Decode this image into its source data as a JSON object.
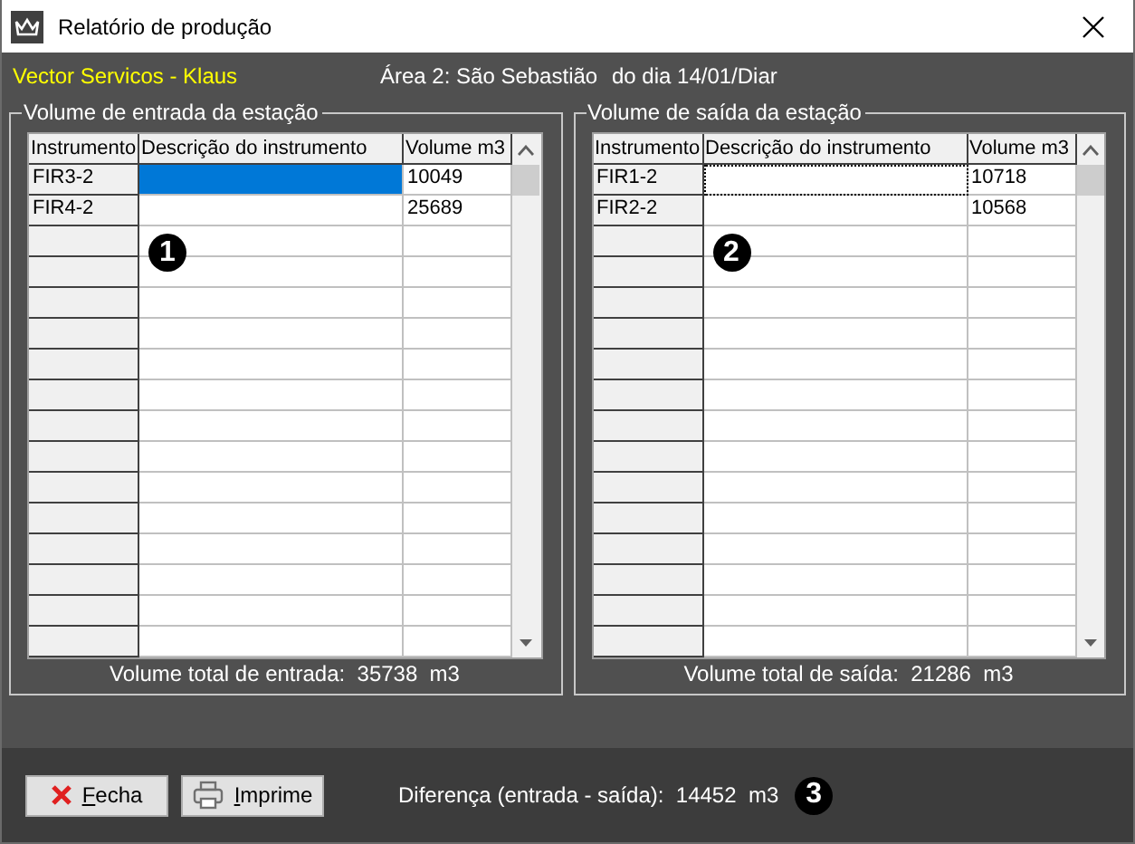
{
  "window": {
    "title": "Relatório de produção"
  },
  "header": {
    "company": "Vector Servicos - Klaus",
    "area": "Área 2: São Sebastião",
    "date": "do dia 14/01/Diar"
  },
  "panels": [
    {
      "title": "Volume de entrada da estação",
      "columns": [
        "Instrumento",
        "Descrição do instrumento",
        "Volume m3"
      ],
      "rows": [
        {
          "instrument": "FIR3-2",
          "volume": "10049",
          "selected": true,
          "focused": false
        },
        {
          "instrument": "FIR4-2",
          "volume": "25689",
          "selected": false,
          "focused": false
        }
      ],
      "total": "Volume total de entrada:  35738  m3",
      "marker": "1"
    },
    {
      "title": "Volume de saída da estação",
      "columns": [
        "Instrumento",
        "Descrição do instrumento",
        "Volume m3"
      ],
      "rows": [
        {
          "instrument": "FIR1-2",
          "volume": "10718",
          "selected": false,
          "focused": true
        },
        {
          "instrument": "FIR2-2",
          "volume": "10568",
          "selected": false,
          "focused": false
        }
      ],
      "total": "Volume total de saída:  21286  m3",
      "marker": "2"
    }
  ],
  "footer": {
    "buttons": [
      {
        "label": "Fecha",
        "kind": "close"
      },
      {
        "label": "Imprime",
        "kind": "print"
      }
    ],
    "difference": "Diferença (entrada - saída):  14452  m3",
    "marker": "3"
  }
}
